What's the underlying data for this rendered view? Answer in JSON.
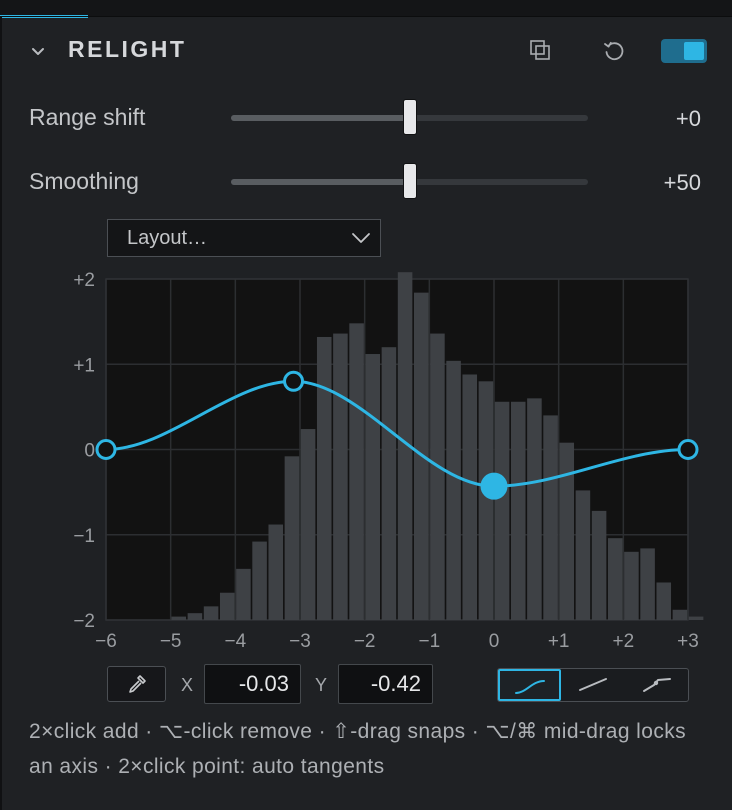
{
  "panel": {
    "title": "RELIGHT",
    "icons": [
      "chevron-down-icon",
      "copy-layers-icon",
      "reset-icon"
    ],
    "enabled": true,
    "accent_color": "#2eb6e4"
  },
  "sliders": [
    {
      "label": "Range shift",
      "value_text": "+0",
      "level": 0.5
    },
    {
      "label": "Smoothing",
      "value_text": "+50",
      "level": 0.5
    }
  ],
  "layout_dropdown": {
    "value": "Layout…"
  },
  "chart_data": {
    "type": "curve-over-histogram",
    "xlim": [
      -6,
      3
    ],
    "ylim": [
      -2,
      2
    ],
    "x_tick_labels": [
      "−6",
      "−5",
      "−4",
      "−3",
      "−2",
      "−1",
      "0",
      "+1",
      "+2",
      "+3"
    ],
    "x_ticks": [
      -6,
      -5,
      -4,
      -3,
      -2,
      -1,
      0,
      1,
      2,
      3
    ],
    "y_tick_labels": [
      "+2",
      "+1",
      "0",
      "−1",
      "−2"
    ],
    "y_ticks": [
      2,
      1,
      0,
      -1,
      -2
    ],
    "grid": true,
    "curve_points": [
      {
        "x": -6,
        "y": 0,
        "selected": false
      },
      {
        "x": -3.1,
        "y": 0.8,
        "selected": false
      },
      {
        "x": 0,
        "y": -0.43,
        "selected": true
      },
      {
        "x": 3,
        "y": 0,
        "selected": false
      }
    ],
    "histogram": {
      "bin_start": -6,
      "bin_width": 0.25,
      "heights": [
        0,
        0,
        0,
        0,
        0.01,
        0.02,
        0.04,
        0.08,
        0.15,
        0.23,
        0.28,
        0.48,
        0.56,
        0.83,
        0.84,
        0.87,
        0.78,
        0.8,
        1.02,
        0.96,
        0.84,
        0.76,
        0.72,
        0.7,
        0.64,
        0.64,
        0.65,
        0.6,
        0.52,
        0.38,
        0.32,
        0.24,
        0.2,
        0.21,
        0.11,
        0.03,
        0.01,
        0,
        0,
        0
      ]
    },
    "curve_color": "#2eb6e4"
  },
  "point_editor": {
    "x_label": "X",
    "x_value": "-0.03",
    "y_label": "Y",
    "y_value": "-0.42",
    "interpolation_modes": [
      "smooth-curve-icon",
      "linear-icon",
      "corner-icon"
    ],
    "active_mode": 0
  },
  "hint": "2×click add · ⌥-click remove · ⇧-drag snaps · ⌥/⌘ mid-drag locks an axis · 2×click point: auto tangents"
}
